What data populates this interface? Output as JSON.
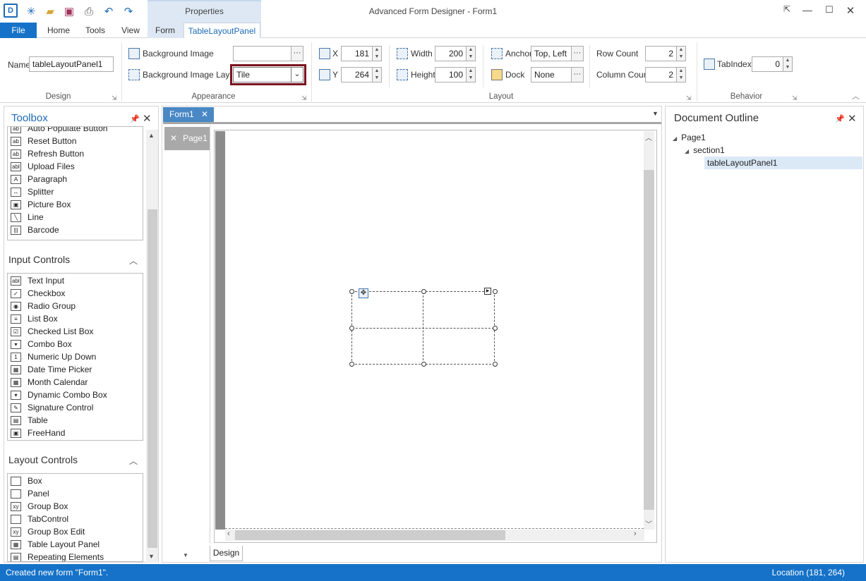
{
  "window": {
    "title": "Advanced Form Designer - Form1",
    "context_group": "Properties"
  },
  "tabs": {
    "file": "File",
    "home": "Home",
    "tools": "Tools",
    "view": "View",
    "form": "Form",
    "table_layout_panel": "TableLayoutPanel"
  },
  "ribbon": {
    "design": {
      "group": "Design",
      "name_label": "Name",
      "name_value": "tableLayoutPanel1"
    },
    "appearance": {
      "group": "Appearance",
      "bg_image_label": "Background Image",
      "bg_image_value": "",
      "bg_layout_label": "Background Image Layout",
      "bg_layout_value": "Tile"
    },
    "layout": {
      "group": "Layout",
      "x_label": "X",
      "x_value": "181",
      "y_label": "Y",
      "y_value": "264",
      "width_label": "Width",
      "width_value": "200",
      "height_label": "Height",
      "height_value": "100",
      "anchor_label": "Anchor",
      "anchor_value": "Top, Left",
      "dock_label": "Dock",
      "dock_value": "None",
      "row_count_label": "Row Count",
      "row_count_value": "2",
      "column_count_label": "Column Count",
      "column_count_value": "2"
    },
    "behavior": {
      "group": "Behavior",
      "tabindex_label": "TabIndex",
      "tabindex_value": "0"
    },
    "ellipsis": "···"
  },
  "toolbox": {
    "title": "Toolbox",
    "common_items": [
      {
        "label": "Auto Populate Button",
        "icon": "ab"
      },
      {
        "label": "Reset Button",
        "icon": "ab"
      },
      {
        "label": "Refresh Button",
        "icon": "ab"
      },
      {
        "label": "Upload Files",
        "icon": "abl"
      },
      {
        "label": "Paragraph",
        "icon": "A"
      },
      {
        "label": "Splitter",
        "icon": "↔"
      },
      {
        "label": "Picture Box",
        "icon": "▣"
      },
      {
        "label": "Line",
        "icon": "╲"
      },
      {
        "label": "Barcode",
        "icon": "|||"
      }
    ],
    "input_header": "Input Controls",
    "input_items": [
      {
        "label": "Text Input",
        "icon": "abl"
      },
      {
        "label": "Checkbox",
        "icon": "✓"
      },
      {
        "label": "Radio Group",
        "icon": "◉"
      },
      {
        "label": "List Box",
        "icon": "≡"
      },
      {
        "label": "Checked List Box",
        "icon": "☑"
      },
      {
        "label": "Combo Box",
        "icon": "▾"
      },
      {
        "label": "Numeric Up Down",
        "icon": "1"
      },
      {
        "label": "Date Time Picker",
        "icon": "▦"
      },
      {
        "label": "Month Calendar",
        "icon": "▦"
      },
      {
        "label": "Dynamic Combo Box",
        "icon": "▾"
      },
      {
        "label": "Signature Control",
        "icon": "✎"
      },
      {
        "label": "Table",
        "icon": "▤"
      },
      {
        "label": "FreeHand",
        "icon": "▣"
      }
    ],
    "layout_header": "Layout Controls",
    "layout_items": [
      {
        "label": "Box",
        "icon": ""
      },
      {
        "label": "Panel",
        "icon": ""
      },
      {
        "label": "Group Box",
        "icon": "xy"
      },
      {
        "label": "TabControl",
        "icon": ""
      },
      {
        "label": "Group Box Edit",
        "icon": "xy"
      },
      {
        "label": "Table Layout Panel",
        "icon": "▦"
      },
      {
        "label": "Repeating Elements",
        "icon": "▤"
      }
    ]
  },
  "designer": {
    "doc_tab": "Form1",
    "page_tab": "Page1",
    "bottom_tab": "Design"
  },
  "outline": {
    "title": "Document Outline",
    "nodes": [
      "Page1",
      "section1",
      "tableLayoutPanel1"
    ]
  },
  "status": {
    "message": "Created new form \"Form1\".",
    "location": "Location (181, 264)"
  },
  "colors": {
    "accent": "#1572c8",
    "highlight_box": "#7b1320",
    "selection": "#dbe8f6"
  }
}
